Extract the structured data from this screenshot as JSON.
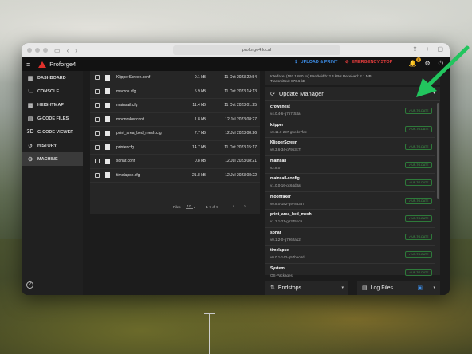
{
  "browser": {
    "url": "proforge4.local"
  },
  "app": {
    "title": "Proforge4",
    "upload_label": "UPLOAD & PRINT",
    "estop_label": "EMERGENCY STOP",
    "notification_count": "1"
  },
  "sidebar": {
    "items": [
      {
        "label": "DASHBOARD",
        "icon": "dashboard-icon"
      },
      {
        "label": "CONSOLE",
        "icon": "console-icon"
      },
      {
        "label": "HEIGHTMAP",
        "icon": "heightmap-icon"
      },
      {
        "label": "G-CODE FILES",
        "icon": "files-icon"
      },
      {
        "label": "G-CODE VIEWER",
        "icon": "viewer-icon"
      },
      {
        "label": "HISTORY",
        "icon": "history-icon"
      },
      {
        "label": "MACHINE",
        "icon": "machine-icon",
        "active": true
      }
    ]
  },
  "files": {
    "rows": [
      {
        "name": "KlipperScreen.conf",
        "size": "0.1 kB",
        "date": "11 Oct 2023 22:54"
      },
      {
        "name": "macros.cfg",
        "size": "5.9 kB",
        "date": "11 Oct 2023 14:13"
      },
      {
        "name": "mainsail.cfg",
        "size": "11.4 kB",
        "date": "11 Oct 2023 01:25"
      },
      {
        "name": "moonraker.conf",
        "size": "1.8 kB",
        "date": "12 Jul 2023 08:27"
      },
      {
        "name": "print_area_bed_mesh.cfg",
        "size": "7.7 kB",
        "date": "12 Jul 2023 08:26"
      },
      {
        "name": "printer.cfg",
        "size": "14.7 kB",
        "date": "11 Oct 2023 15:17"
      },
      {
        "name": "sonar.conf",
        "size": "0.8 kB",
        "date": "12 Jul 2023 08:21"
      },
      {
        "name": "timelapse.cfg",
        "size": "21.8 kB",
        "date": "12 Jul 2023 08:22"
      }
    ],
    "pager": {
      "files_label": "Files",
      "per_page": "10",
      "range": "1-9 of 9"
    }
  },
  "info": {
    "line1": "Interface: (192.168.0.xx)   Bandwidth: 2.4 kB/s   Received: 2.1 MB",
    "line2": "Transmitted: 876.6 kB"
  },
  "update_manager": {
    "title": "Update Manager",
    "status_label": "UP-TO-DATE",
    "items": [
      {
        "name": "crowsnest",
        "version": "v4.0.4-6-g767c53a",
        "uptodate": true
      },
      {
        "name": "klipper",
        "version": "v0.11.0-297-g5edc7fee",
        "uptodate": true
      },
      {
        "name": "KlipperScreen",
        "version": "v0.3.6-34-g79b3c7f",
        "uptodate": true
      },
      {
        "name": "mainsail",
        "version": "v2.8.0",
        "uptodate": true
      },
      {
        "name": "mainsail-config",
        "version": "v1.0.0-16-gc64d3af",
        "uptodate": true
      },
      {
        "name": "moonraker",
        "version": "v0.8.0-182-g9785387",
        "uptodate": true
      },
      {
        "name": "print_area_bed_mesh",
        "version": "v1.2.1-21-g53451c9",
        "uptodate": true
      },
      {
        "name": "sonar",
        "version": "v0.1.2-0-g7962a12",
        "uptodate": true
      },
      {
        "name": "timelapse",
        "version": "v0.0.1-142-g57bec0d",
        "uptodate": true
      },
      {
        "name": "System",
        "version": "OS-Packages",
        "uptodate": true
      }
    ]
  },
  "panels": {
    "endstops_label": "Endstops",
    "logfiles_label": "Log Files"
  },
  "colors": {
    "accent_blue": "#3d8ee8",
    "estop_red": "#e83d3d",
    "success_green": "#3fa34d",
    "annotation_arrow": "#22c55e"
  }
}
